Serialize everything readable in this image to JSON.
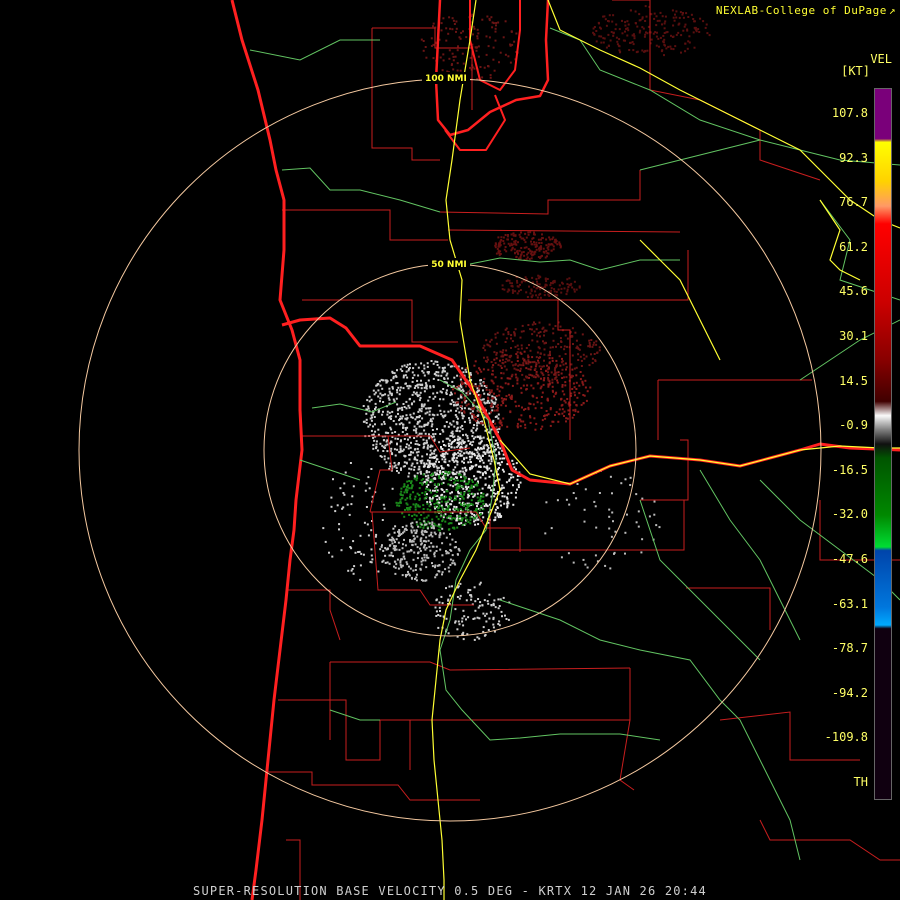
{
  "credit": {
    "text": "NEXLAB-College of DuPage",
    "link_icon": "external-link-icon"
  },
  "legend": {
    "product": "VEL",
    "unit": "[KT]",
    "labels": [
      "107.8",
      "92.3",
      "76.7",
      "61.2",
      "45.6",
      "30.1",
      "14.5",
      "-0.9",
      "-16.5",
      "-32.0",
      "-47.6",
      "-63.1",
      "-78.7",
      "-94.2",
      "-109.8",
      "TH"
    ]
  },
  "range_rings": {
    "outer": "100 NMI",
    "inner": "50 NMI"
  },
  "status_line": "SUPER-RESOLUTION BASE VELOCITY 0.5 DEG - KRTX 12 JAN 26 20:44",
  "colors": {
    "background": "#000000",
    "rings": "#f5c9a0",
    "county_borders": "#cc1f1f",
    "coastline": "#ff2020",
    "highways": "#ffff33",
    "rivers": "#6fcf6f",
    "text": "#ffff66",
    "inbound": "#1a8a1a",
    "outbound": "#8a1a1a",
    "near_zero": "#cfcfcf"
  }
}
